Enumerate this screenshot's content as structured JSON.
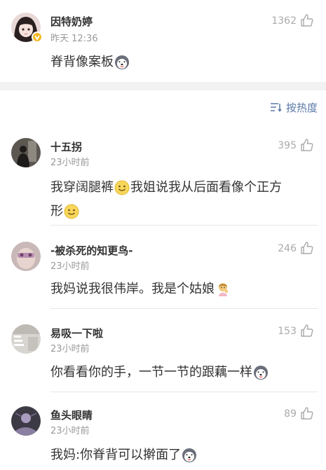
{
  "post": {
    "author": "因特奶婷",
    "time": "昨天 12:36",
    "likes": "1362",
    "text": "脊背像案板",
    "emoji": "husky-face"
  },
  "sort": {
    "label": "按热度",
    "icon": "sort-lines-icon"
  },
  "comments": [
    {
      "author": "十五拐",
      "time": "23小时前",
      "likes": "395",
      "line1": "我穿阔腿裤",
      "line1b": "我姐说我从后面看像个正方",
      "line2": "形",
      "emoji": "smiley-face"
    },
    {
      "author": "-被杀死的知更鸟-",
      "time": "23小时前",
      "likes": "246",
      "text": "我妈说我很伟岸。我是个姑娘",
      "emoji": "girl-emoji"
    },
    {
      "author": "易吸一下啦",
      "time": "23小时前",
      "likes": "153",
      "text": "你看看你的手，一节一节的跟藕一样",
      "emoji": "husky-face"
    },
    {
      "author": "鱼头眼睛",
      "time": "23小时前",
      "likes": "89",
      "text": "我妈:你脊背可以擀面了",
      "emoji": "husky-face"
    }
  ],
  "colors": {
    "accent": "#5a78a8",
    "muted": "#999999",
    "badge": "#f5b722"
  }
}
